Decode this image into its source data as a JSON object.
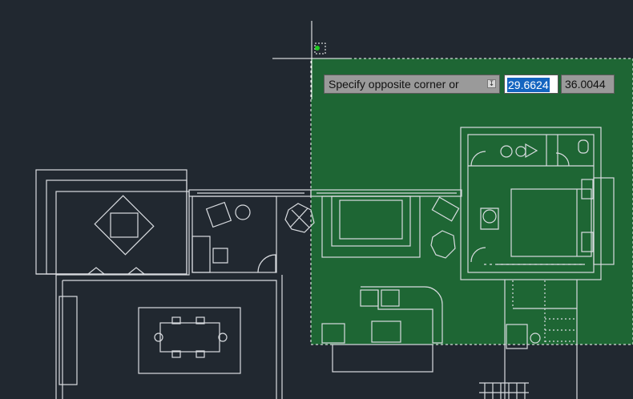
{
  "command": {
    "prompt_text": "Specify opposite corner or",
    "x_value": "29.6624",
    "y_value": "36.0044"
  },
  "colors": {
    "background": "#212830",
    "linework": "#d9dce0",
    "selection_fill": "#1e6b35",
    "grip": "#22cc22"
  },
  "icons": {
    "prompt_dropdown": "down-arrow-icon",
    "crosshair": "crosshair-cursor-icon"
  }
}
